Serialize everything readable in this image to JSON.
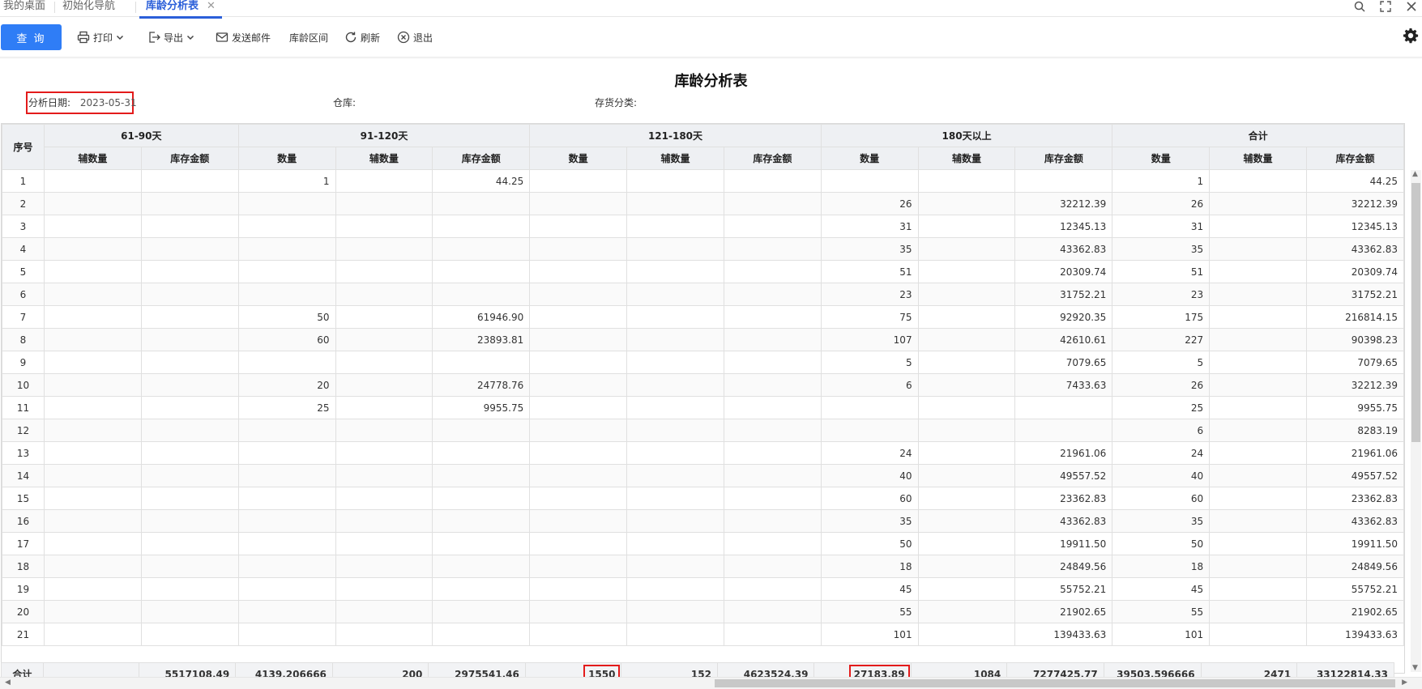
{
  "tabs": [
    {
      "label": "我的桌面"
    },
    {
      "label": "初始化导航"
    },
    {
      "label": "库龄分析表",
      "active": true
    }
  ],
  "toolbar": {
    "query_label": "查 询",
    "print_label": "打印",
    "export_label": "导出",
    "email_label": "发送邮件",
    "aging_range_label": "库龄区间",
    "refresh_label": "刷新",
    "exit_label": "退出"
  },
  "report": {
    "title": "库龄分析表",
    "date_label": "分析日期:",
    "date_value": "2023-05-31",
    "warehouse_label": "仓库:",
    "category_label": "存货分类:"
  },
  "table": {
    "seq_header": "序号",
    "groups": [
      "61-90天",
      "91-120天",
      "121-180天",
      "180天以上",
      "合计"
    ],
    "sub": {
      "qty": "数量",
      "aux": "辅数量",
      "amt": "库存金额"
    },
    "rows": [
      {
        "seq": "1",
        "g1_aux": "",
        "g1_amt": "",
        "g2_qty": "1",
        "g2_aux": "",
        "g2_amt": "44.25",
        "g3_qty": "",
        "g3_aux": "",
        "g3_amt": "",
        "g4_qty": "",
        "g4_aux": "",
        "g4_amt": "",
        "t_qty": "1",
        "t_aux": "",
        "t_amt": "44.25"
      },
      {
        "seq": "2",
        "g1_aux": "",
        "g1_amt": "",
        "g2_qty": "",
        "g2_aux": "",
        "g2_amt": "",
        "g3_qty": "",
        "g3_aux": "",
        "g3_amt": "",
        "g4_qty": "26",
        "g4_aux": "",
        "g4_amt": "32212.39",
        "t_qty": "26",
        "t_aux": "",
        "t_amt": "32212.39"
      },
      {
        "seq": "3",
        "g1_aux": "",
        "g1_amt": "",
        "g2_qty": "",
        "g2_aux": "",
        "g2_amt": "",
        "g3_qty": "",
        "g3_aux": "",
        "g3_amt": "",
        "g4_qty": "31",
        "g4_aux": "",
        "g4_amt": "12345.13",
        "t_qty": "31",
        "t_aux": "",
        "t_amt": "12345.13"
      },
      {
        "seq": "4",
        "g1_aux": "",
        "g1_amt": "",
        "g2_qty": "",
        "g2_aux": "",
        "g2_amt": "",
        "g3_qty": "",
        "g3_aux": "",
        "g3_amt": "",
        "g4_qty": "35",
        "g4_aux": "",
        "g4_amt": "43362.83",
        "t_qty": "35",
        "t_aux": "",
        "t_amt": "43362.83"
      },
      {
        "seq": "5",
        "g1_aux": "",
        "g1_amt": "",
        "g2_qty": "",
        "g2_aux": "",
        "g2_amt": "",
        "g3_qty": "",
        "g3_aux": "",
        "g3_amt": "",
        "g4_qty": "51",
        "g4_aux": "",
        "g4_amt": "20309.74",
        "t_qty": "51",
        "t_aux": "",
        "t_amt": "20309.74"
      },
      {
        "seq": "6",
        "g1_aux": "",
        "g1_amt": "",
        "g2_qty": "",
        "g2_aux": "",
        "g2_amt": "",
        "g3_qty": "",
        "g3_aux": "",
        "g3_amt": "",
        "g4_qty": "23",
        "g4_aux": "",
        "g4_amt": "31752.21",
        "t_qty": "23",
        "t_aux": "",
        "t_amt": "31752.21"
      },
      {
        "seq": "7",
        "g1_aux": "",
        "g1_amt": "",
        "g2_qty": "50",
        "g2_aux": "",
        "g2_amt": "61946.90",
        "g3_qty": "",
        "g3_aux": "",
        "g3_amt": "",
        "g4_qty": "75",
        "g4_aux": "",
        "g4_amt": "92920.35",
        "t_qty": "175",
        "t_aux": "",
        "t_amt": "216814.15"
      },
      {
        "seq": "8",
        "g1_aux": "",
        "g1_amt": "",
        "g2_qty": "60",
        "g2_aux": "",
        "g2_amt": "23893.81",
        "g3_qty": "",
        "g3_aux": "",
        "g3_amt": "",
        "g4_qty": "107",
        "g4_aux": "",
        "g4_amt": "42610.61",
        "t_qty": "227",
        "t_aux": "",
        "t_amt": "90398.23"
      },
      {
        "seq": "9",
        "g1_aux": "",
        "g1_amt": "",
        "g2_qty": "",
        "g2_aux": "",
        "g2_amt": "",
        "g3_qty": "",
        "g3_aux": "",
        "g3_amt": "",
        "g4_qty": "5",
        "g4_aux": "",
        "g4_amt": "7079.65",
        "t_qty": "5",
        "t_aux": "",
        "t_amt": "7079.65"
      },
      {
        "seq": "10",
        "g1_aux": "",
        "g1_amt": "",
        "g2_qty": "20",
        "g2_aux": "",
        "g2_amt": "24778.76",
        "g3_qty": "",
        "g3_aux": "",
        "g3_amt": "",
        "g4_qty": "6",
        "g4_aux": "",
        "g4_amt": "7433.63",
        "t_qty": "26",
        "t_aux": "",
        "t_amt": "32212.39"
      },
      {
        "seq": "11",
        "g1_aux": "",
        "g1_amt": "",
        "g2_qty": "25",
        "g2_aux": "",
        "g2_amt": "9955.75",
        "g3_qty": "",
        "g3_aux": "",
        "g3_amt": "",
        "g4_qty": "",
        "g4_aux": "",
        "g4_amt": "",
        "t_qty": "25",
        "t_aux": "",
        "t_amt": "9955.75"
      },
      {
        "seq": "12",
        "g1_aux": "",
        "g1_amt": "",
        "g2_qty": "",
        "g2_aux": "",
        "g2_amt": "",
        "g3_qty": "",
        "g3_aux": "",
        "g3_amt": "",
        "g4_qty": "",
        "g4_aux": "",
        "g4_amt": "",
        "t_qty": "6",
        "t_aux": "",
        "t_amt": "8283.19"
      },
      {
        "seq": "13",
        "g1_aux": "",
        "g1_amt": "",
        "g2_qty": "",
        "g2_aux": "",
        "g2_amt": "",
        "g3_qty": "",
        "g3_aux": "",
        "g3_amt": "",
        "g4_qty": "24",
        "g4_aux": "",
        "g4_amt": "21961.06",
        "t_qty": "24",
        "t_aux": "",
        "t_amt": "21961.06"
      },
      {
        "seq": "14",
        "g1_aux": "",
        "g1_amt": "",
        "g2_qty": "",
        "g2_aux": "",
        "g2_amt": "",
        "g3_qty": "",
        "g3_aux": "",
        "g3_amt": "",
        "g4_qty": "40",
        "g4_aux": "",
        "g4_amt": "49557.52",
        "t_qty": "40",
        "t_aux": "",
        "t_amt": "49557.52"
      },
      {
        "seq": "15",
        "g1_aux": "",
        "g1_amt": "",
        "g2_qty": "",
        "g2_aux": "",
        "g2_amt": "",
        "g3_qty": "",
        "g3_aux": "",
        "g3_amt": "",
        "g4_qty": "60",
        "g4_aux": "",
        "g4_amt": "23362.83",
        "t_qty": "60",
        "t_aux": "",
        "t_amt": "23362.83"
      },
      {
        "seq": "16",
        "g1_aux": "",
        "g1_amt": "",
        "g2_qty": "",
        "g2_aux": "",
        "g2_amt": "",
        "g3_qty": "",
        "g3_aux": "",
        "g3_amt": "",
        "g4_qty": "35",
        "g4_aux": "",
        "g4_amt": "43362.83",
        "t_qty": "35",
        "t_aux": "",
        "t_amt": "43362.83"
      },
      {
        "seq": "17",
        "g1_aux": "",
        "g1_amt": "",
        "g2_qty": "",
        "g2_aux": "",
        "g2_amt": "",
        "g3_qty": "",
        "g3_aux": "",
        "g3_amt": "",
        "g4_qty": "50",
        "g4_aux": "",
        "g4_amt": "19911.50",
        "t_qty": "50",
        "t_aux": "",
        "t_amt": "19911.50"
      },
      {
        "seq": "18",
        "g1_aux": "",
        "g1_amt": "",
        "g2_qty": "",
        "g2_aux": "",
        "g2_amt": "",
        "g3_qty": "",
        "g3_aux": "",
        "g3_amt": "",
        "g4_qty": "18",
        "g4_aux": "",
        "g4_amt": "24849.56",
        "t_qty": "18",
        "t_aux": "",
        "t_amt": "24849.56"
      },
      {
        "seq": "19",
        "g1_aux": "",
        "g1_amt": "",
        "g2_qty": "",
        "g2_aux": "",
        "g2_amt": "",
        "g3_qty": "",
        "g3_aux": "",
        "g3_amt": "",
        "g4_qty": "45",
        "g4_aux": "",
        "g4_amt": "55752.21",
        "t_qty": "45",
        "t_aux": "",
        "t_amt": "55752.21"
      },
      {
        "seq": "20",
        "g1_aux": "",
        "g1_amt": "",
        "g2_qty": "",
        "g2_aux": "",
        "g2_amt": "",
        "g3_qty": "",
        "g3_aux": "",
        "g3_amt": "",
        "g4_qty": "55",
        "g4_aux": "",
        "g4_amt": "21902.65",
        "t_qty": "55",
        "t_aux": "",
        "t_amt": "21902.65"
      },
      {
        "seq": "21",
        "g1_aux": "",
        "g1_amt": "",
        "g2_qty": "",
        "g2_aux": "",
        "g2_amt": "",
        "g3_qty": "",
        "g3_aux": "",
        "g3_amt": "",
        "g4_qty": "101",
        "g4_aux": "",
        "g4_amt": "139433.63",
        "t_qty": "101",
        "t_aux": "",
        "t_amt": "139433.63"
      }
    ],
    "totals": {
      "label": "合计",
      "g1_aux": "",
      "g1_amt": "5517108.49",
      "g2_qty": "4139.206666",
      "g2_aux": "200",
      "g2_amt": "2975541.46",
      "g3_qty": "1550",
      "g3_aux": "152",
      "g3_amt": "4623524.39",
      "g4_qty": "27183.89",
      "g4_aux": "1084",
      "g4_amt": "7277425.77",
      "t_qty": "39503.596666",
      "t_aux": "2471",
      "t_amt": "33122814.33"
    }
  },
  "colors": {
    "primary": "#2f7df6",
    "highlight": "#e31b1b",
    "tab_active": "#2b5fd9"
  }
}
